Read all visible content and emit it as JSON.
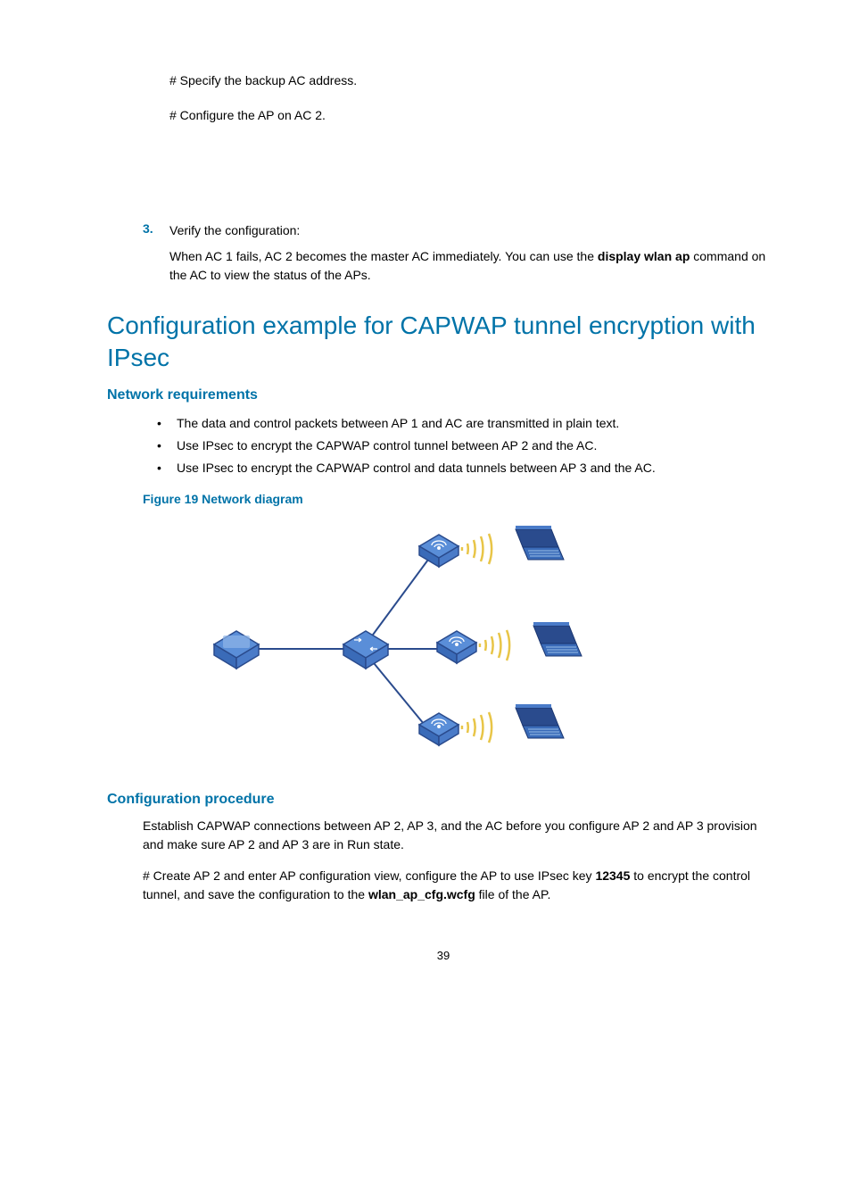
{
  "top": {
    "line1": "# Specify the backup AC address.",
    "line2": "# Configure the AP on AC 2."
  },
  "step3": {
    "num": "3.",
    "title": "Verify the configuration:",
    "sub_a": "When AC 1 fails, AC 2 becomes the master AC immediately. You can use the ",
    "sub_bold": "display wlan ap",
    "sub_b": " command on the AC to view the status of the APs."
  },
  "h1": "Configuration example for CAPWAP tunnel encryption with IPsec",
  "h2_req": "Network requirements",
  "bullets": [
    "The data and control packets between AP 1 and AC are transmitted in plain text.",
    "Use IPsec to encrypt the CAPWAP control tunnel between AP 2 and the AC.",
    "Use IPsec to encrypt the CAPWAP control and data tunnels between AP 3 and the AC."
  ],
  "figure_caption": "Figure 19 Network diagram",
  "h2_proc": "Configuration procedure",
  "proc_p1": "Establish CAPWAP connections between AP 2, AP 3, and the AC before you configure AP 2 and AP 3 provision and make sure AP 2 and AP 3 are in Run state.",
  "proc_p2_a": "# Create AP 2 and enter AP configuration view, configure the AP to use IPsec key ",
  "proc_p2_bold1": "12345",
  "proc_p2_b": " to encrypt the control tunnel, and save the configuration to the ",
  "proc_p2_bold2": "wlan_ap_cfg.wcfg",
  "proc_p2_c": " file of the AP.",
  "page_num": "39"
}
